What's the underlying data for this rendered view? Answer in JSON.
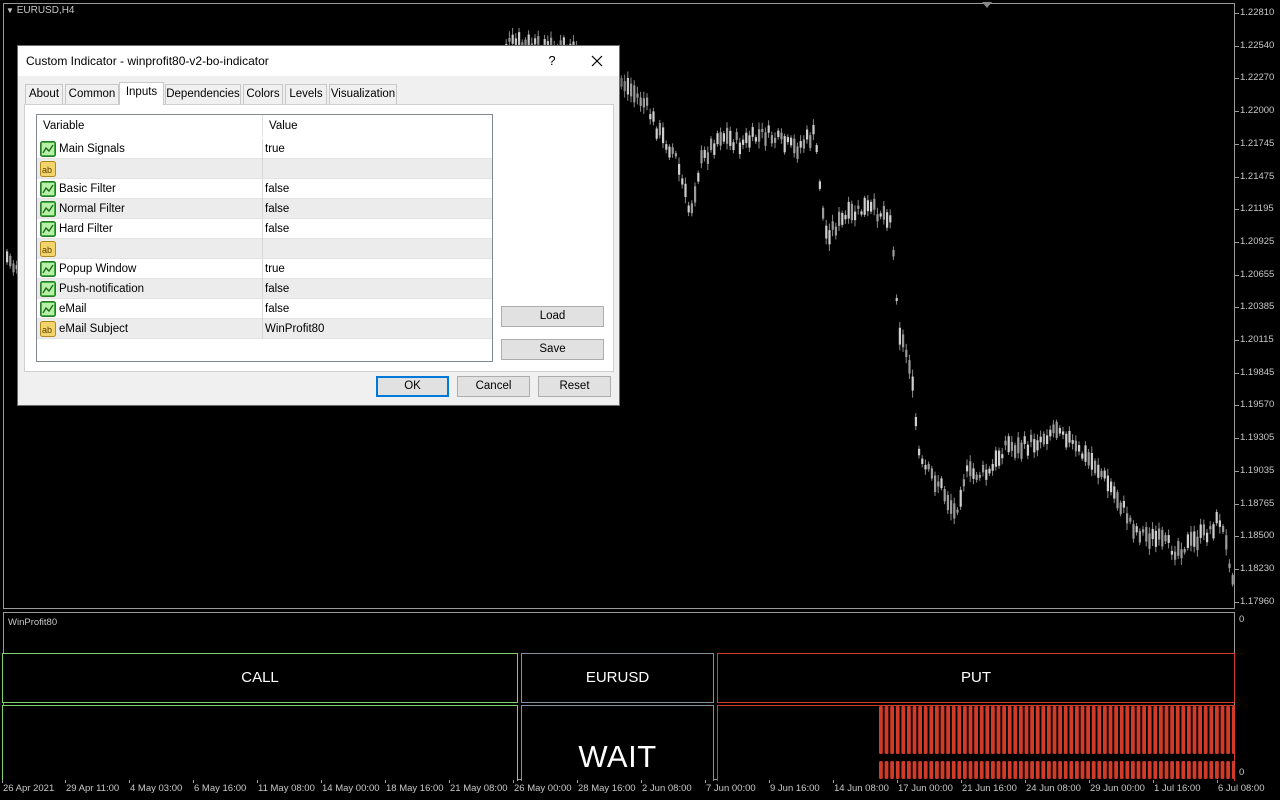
{
  "chart": {
    "symbol_timeframe": "EURUSD,H4",
    "price_axis": [
      "1.22810",
      "1.22540",
      "1.22270",
      "1.22000",
      "1.21745",
      "1.21475",
      "1.21195",
      "1.20925",
      "1.20655",
      "1.20385",
      "1.20115",
      "1.19845",
      "1.19570",
      "1.19305",
      "1.19035",
      "1.18765",
      "1.18500",
      "1.18230",
      "1.17960"
    ],
    "time_axis": [
      "26 Apr 2021",
      "29 Apr 11:00",
      "4 May 03:00",
      "6 May 16:00",
      "11 May 08:00",
      "14 May 00:00",
      "18 May 16:00",
      "21 May 08:00",
      "26 May 00:00",
      "28 May 16:00",
      "2 Jun 08:00",
      "7 Jun 00:00",
      "9 Jun 16:00",
      "14 Jun 08:00",
      "17 Jun 00:00",
      "21 Jun 16:00",
      "24 Jun 08:00",
      "29 Jun 00:00",
      "1 Jul 16:00",
      "6 Jul 08:00"
    ]
  },
  "indicator": {
    "name": "WinProfit80",
    "scale_top": "0",
    "scale_bottom": "0",
    "call_label": "CALL",
    "symbol_label": "EURUSD",
    "put_label": "PUT",
    "status_label": "WAIT",
    "call_color": "#7fd36b",
    "put_color": "#d23a2a"
  },
  "dialog": {
    "title": "Custom Indicator - winprofit80-v2-bo-indicator",
    "help_label": "?",
    "tabs": [
      {
        "label": "About"
      },
      {
        "label": "Common"
      },
      {
        "label": "Inputs"
      },
      {
        "label": "Dependencies"
      },
      {
        "label": "Colors"
      },
      {
        "label": "Levels"
      },
      {
        "label": "Visualization"
      }
    ],
    "active_tab": "Inputs",
    "table": {
      "col_variable": "Variable",
      "col_value": "Value",
      "rows": [
        {
          "icon": "bool-param-icon",
          "variable": "Main Signals",
          "value": "true"
        },
        {
          "icon": "string-param-icon",
          "variable": "",
          "value": ""
        },
        {
          "icon": "bool-param-icon",
          "variable": "Basic Filter",
          "value": "false"
        },
        {
          "icon": "bool-param-icon",
          "variable": "Normal Filter",
          "value": "false"
        },
        {
          "icon": "bool-param-icon",
          "variable": "Hard Filter",
          "value": "false"
        },
        {
          "icon": "string-param-icon",
          "variable": "",
          "value": ""
        },
        {
          "icon": "bool-param-icon",
          "variable": "Popup Window",
          "value": "true"
        },
        {
          "icon": "bool-param-icon",
          "variable": "Push-notification",
          "value": "false"
        },
        {
          "icon": "bool-param-icon",
          "variable": "eMail",
          "value": "false"
        },
        {
          "icon": "string-param-icon",
          "variable": "eMail Subject",
          "value": "WinProfit80"
        }
      ]
    },
    "load_label": "Load",
    "save_label": "Save",
    "ok_label": "OK",
    "cancel_label": "Cancel",
    "reset_label": "Reset"
  }
}
